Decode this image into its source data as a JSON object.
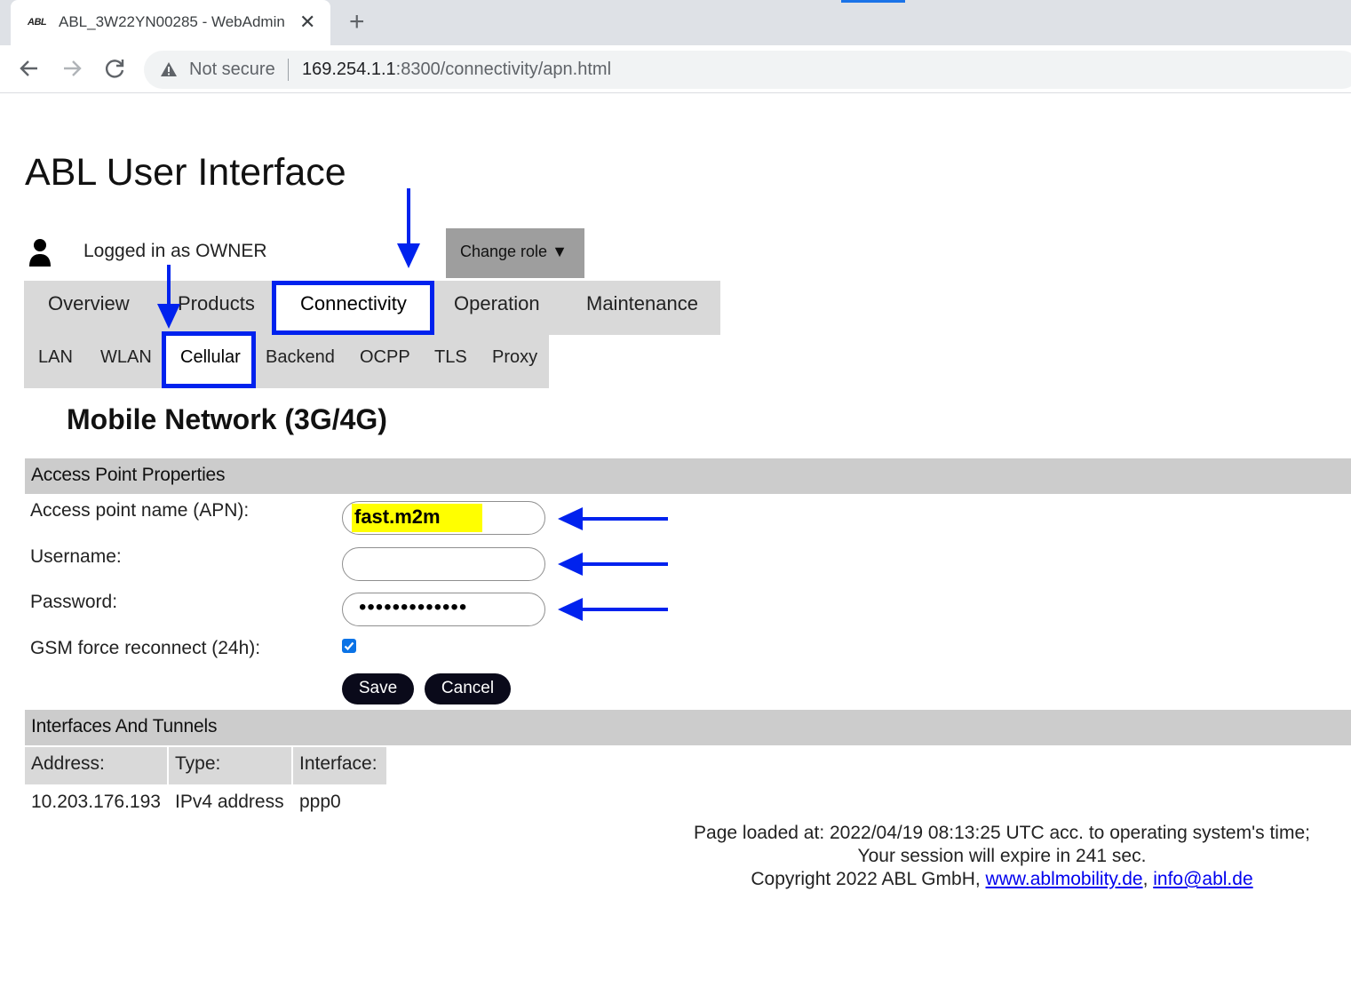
{
  "browser": {
    "tab_favicon": "ABL",
    "tab_title": "ABL_3W22YN00285 - WebAdmin",
    "tab_close": "✕",
    "new_tab": "+",
    "not_secure": "Not secure",
    "url_host": "169.254.1.1",
    "url_path": ":8300/connectivity/apn.html"
  },
  "header": {
    "title": "ABL User Interface",
    "logged_in": "Logged in as OWNER",
    "change_role": "Change role ▼"
  },
  "main_nav": [
    "Overview",
    "Products",
    "Connectivity",
    "Operation",
    "Maintenance"
  ],
  "main_nav_active": "Connectivity",
  "sub_nav": [
    "LAN",
    "WLAN",
    "Cellular",
    "Backend",
    "OCPP",
    "TLS",
    "Proxy"
  ],
  "sub_nav_active": "Cellular",
  "section_title": "Mobile Network (3G/4G)",
  "apn_section": {
    "header": "Access Point Properties",
    "apn_label": "Access point name (APN):",
    "apn_value": "fast.m2m",
    "username_label": "Username:",
    "username_value": "",
    "password_label": "Password:",
    "password_value": "•••••••••••••",
    "gsm_label": "GSM force reconnect (24h):",
    "gsm_checked": true,
    "save": "Save",
    "cancel": "Cancel"
  },
  "interfaces_section": {
    "header": "Interfaces And Tunnels",
    "columns": [
      "Address:",
      "Type:",
      "Interface:"
    ],
    "rows": [
      [
        "10.203.176.193",
        "IPv4 address",
        "ppp0"
      ]
    ]
  },
  "footer": {
    "line1": "Page loaded at: 2022/04/19 08:13:25 UTC acc. to operating system's time;",
    "line2": "Your session will expire in 241 sec.",
    "line3_prefix": "Copyright 2022 ABL GmbH, ",
    "link1": "www.ablmobility.de",
    "line3_sep": ", ",
    "link2": "info@abl.de"
  },
  "colors": {
    "annotation_blue": "#0022ee",
    "highlight_yellow": "#ffff00",
    "nav_gray": "#d9d9d9",
    "section_gray": "#cccccc",
    "button_dark": "#0a0a1a"
  },
  "icons": [
    "back-arrow-icon",
    "forward-arrow-icon",
    "reload-icon",
    "warning-icon",
    "user-icon",
    "annotation-arrow-icon"
  ]
}
